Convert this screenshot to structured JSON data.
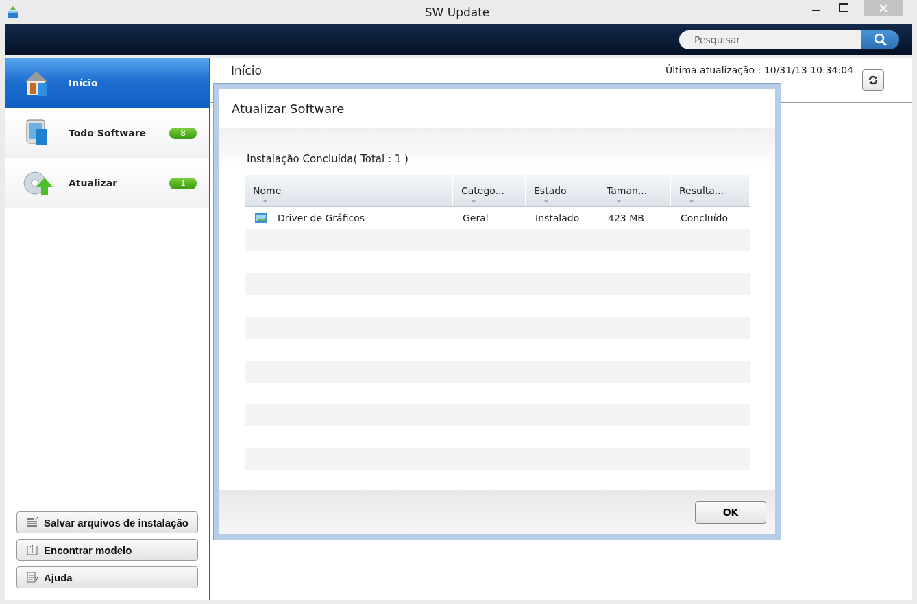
{
  "window": {
    "title": "SW Update"
  },
  "search": {
    "placeholder": "Pesquisar"
  },
  "sidebar": {
    "items": [
      {
        "label": "Início",
        "selected": true,
        "kind": "home"
      },
      {
        "label": "Todo Software",
        "selected": false,
        "kind": "software",
        "badge": "8"
      },
      {
        "label": "Atualizar",
        "selected": false,
        "kind": "update",
        "badge": "1"
      }
    ],
    "buttons": [
      {
        "label": "Salvar arquivos de instalação",
        "kind": "save"
      },
      {
        "label": "Encontrar modelo",
        "kind": "find"
      },
      {
        "label": "Ajuda",
        "kind": "help"
      }
    ]
  },
  "main": {
    "title": "Início",
    "last_update": "Última atualização : 10/31/13 10:34:04"
  },
  "dialog": {
    "title": "Atualizar Software",
    "summary": "Instalação Concluída( Total : 1 )",
    "table": {
      "columns": [
        "Nome",
        "Catego...",
        "Estado",
        "Taman...",
        "Resulta..."
      ],
      "rows": [
        [
          "Driver de Gráficos",
          "Geral",
          "Instalado",
          "423 MB",
          "Concluído"
        ]
      ]
    },
    "buttons": [
      "OK"
    ]
  }
}
